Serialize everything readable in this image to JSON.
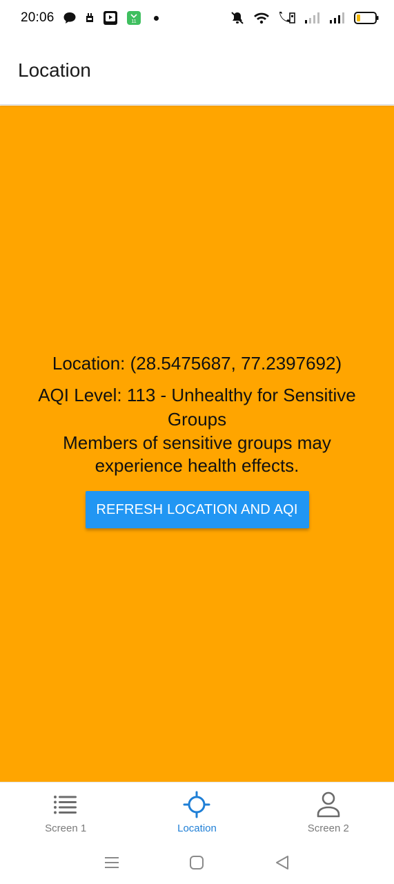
{
  "status_bar": {
    "time": "20:06",
    "icons_left": [
      "chat-bubble-icon",
      "sim-icon",
      "play-store-icon",
      "app-notification-icon",
      "notification-dot"
    ],
    "icons_right": [
      "mute-icon",
      "wifi-icon",
      "volte-icon",
      "signal-1-icon",
      "signal-2-icon",
      "battery-icon"
    ],
    "battery_level": 0.12
  },
  "app_bar": {
    "title": "Location"
  },
  "main": {
    "background_color": "#FFA500",
    "location_text": "Location: (28.5475687, 77.2397692)",
    "aqi_text": "AQI Level: 113 - Unhealthy for Sensitive Groups",
    "description_text": "Members of sensitive groups may experience health effects.",
    "refresh_button_label": "REFRESH LOCATION AND AQI",
    "button_color": "#2196F3"
  },
  "tabs": [
    {
      "label": "Screen 1",
      "icon": "list-icon",
      "active": false
    },
    {
      "label": "Location",
      "icon": "crosshair-icon",
      "active": true
    },
    {
      "label": "Screen 2",
      "icon": "person-icon",
      "active": false
    }
  ],
  "nav_bar": {
    "buttons": [
      "menu-icon",
      "home-icon",
      "back-icon"
    ]
  }
}
